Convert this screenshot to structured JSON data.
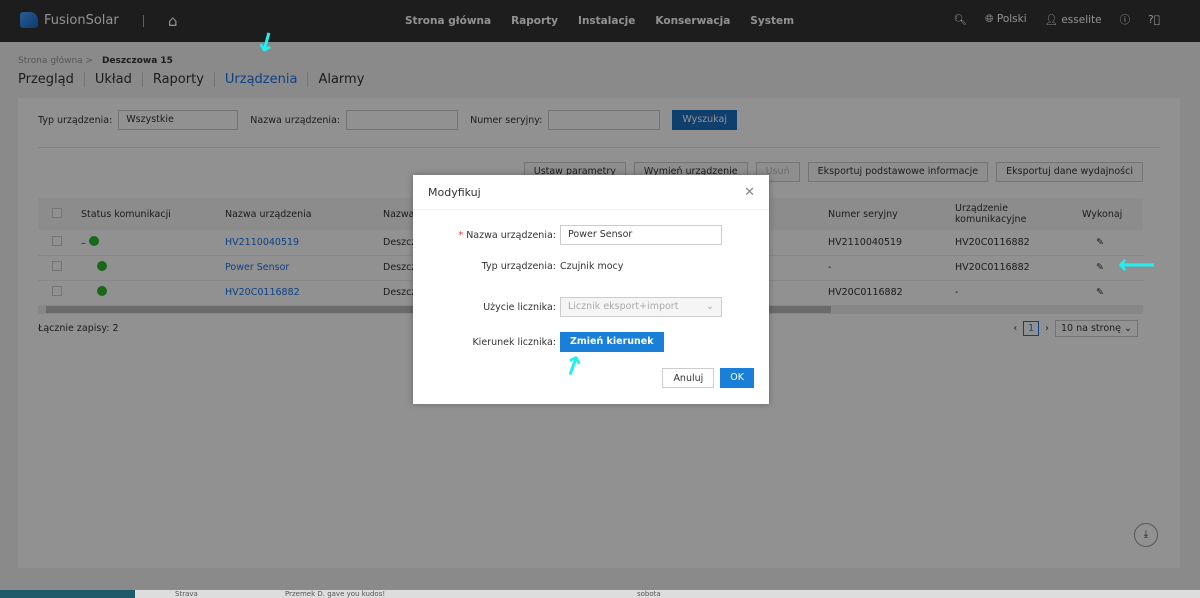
{
  "header": {
    "brand": "FusionSolar",
    "nav": [
      "Strona główna",
      "Raporty",
      "Instalacje",
      "Konserwacja",
      "System"
    ],
    "language": "Polski",
    "user": "esselite"
  },
  "breadcrumb": {
    "root": "Strona główna",
    "current": "Deszczowa 15"
  },
  "tabs": [
    "Przegląd",
    "Układ",
    "Raporty",
    "Urządzenia",
    "Alarmy"
  ],
  "filter": {
    "type_label": "Typ urządzenia:",
    "type_value": "Wszystkie",
    "name_label": "Nazwa urządzenia:",
    "serial_label": "Numer seryjny:",
    "search": "Wyszukaj"
  },
  "toolbar": [
    "Ustaw parametry",
    "Wymień urządzenie",
    "Usuń",
    "Eksportuj podstawowe informacje",
    "Eksportuj dane wydajności"
  ],
  "table": {
    "headers": [
      "Status komunikacji",
      "Nazwa urządzenia",
      "Nazwa",
      "Numer seryjny",
      "Urządzenie komunikacyjne",
      "Wykonaj"
    ],
    "rows": [
      {
        "prefix": "–",
        "name": "HV2110040519",
        "station": "Deszcz",
        "serial": "HV2110040519",
        "comm": "HV20C0116882"
      },
      {
        "prefix": "",
        "name": "Power Sensor",
        "station": "Deszcz",
        "serial": "-",
        "comm": "HV20C0116882"
      },
      {
        "prefix": "",
        "name": "HV20C0116882",
        "station": "Deszcz",
        "serial": "HV20C0116882",
        "comm": "-"
      }
    ]
  },
  "total": "Łącznie zapisy: 2",
  "pager": {
    "page": "1",
    "size": "10 na stronę"
  },
  "modal": {
    "title": "Modyfikuj",
    "name_label": "Nazwa urządzenia:",
    "name_value": "Power Sensor",
    "type_label": "Typ urządzenia:",
    "type_value": "Czujnik mocy",
    "usage_label": "Użycie licznika:",
    "usage_value": "Licznik eksport+import",
    "dir_label": "Kierunek licznika:",
    "dir_button": "Zmień kierunek",
    "cancel": "Anuluj",
    "ok": "OK"
  },
  "taskbar": {
    "app": "Strava",
    "message": "Przemek D. gave you kudos!",
    "day": "sobota"
  }
}
